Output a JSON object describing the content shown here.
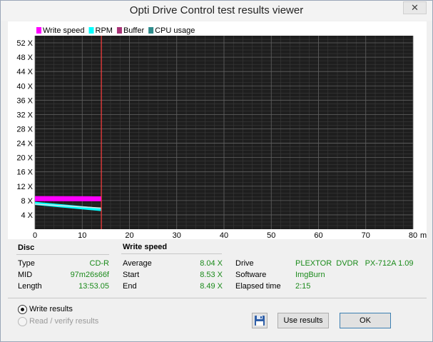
{
  "window": {
    "title": "Opti Drive Control test results viewer",
    "close_glyph": "✕"
  },
  "chart_data": {
    "type": "line",
    "legend": [
      {
        "name": "Write speed",
        "color": "#ff00ff"
      },
      {
        "name": "RPM",
        "color": "#00ffff"
      },
      {
        "name": "Buffer",
        "color": "#aa3377"
      },
      {
        "name": "CPU usage",
        "color": "#2e8b8b"
      }
    ],
    "legend_position": "top-left",
    "xlabel_unit": "min",
    "xlim": [
      0,
      80
    ],
    "ylim": [
      0,
      54
    ],
    "x_ticks": [
      0,
      10,
      20,
      30,
      40,
      50,
      60,
      70,
      80
    ],
    "y_ticks": [
      4,
      8,
      12,
      16,
      20,
      24,
      28,
      32,
      36,
      40,
      44,
      48,
      52
    ],
    "y_tick_suffix": " X",
    "grid": true,
    "background": "#1e1e1e",
    "marker_x": 14.05,
    "marker_color": "#ff3b3b",
    "series": [
      {
        "name": "Write speed",
        "color": "#ff00ff",
        "x": [
          0,
          14.05
        ],
        "y": [
          8.53,
          8.49
        ],
        "band": 1.4
      },
      {
        "name": "RPM",
        "color": "#00ffff",
        "x": [
          0,
          14.05
        ],
        "y": [
          7.2,
          5.5
        ],
        "band": 0.9
      },
      {
        "name": "CPU usage",
        "color": "#e0e0e0",
        "x": [
          0,
          14.05
        ],
        "y": [
          7.0,
          5.9
        ],
        "band": 0.3
      }
    ]
  },
  "disc": {
    "header": "Disc",
    "rows": [
      {
        "label": "Type",
        "value": "CD-R"
      },
      {
        "label": "MID",
        "value": "97m26s66f"
      },
      {
        "label": "Length",
        "value": "13:53.05"
      }
    ]
  },
  "write_speed": {
    "header": "Write speed",
    "rows": [
      {
        "label": "Average",
        "value": "8.04 X"
      },
      {
        "label": "Start",
        "value": "8.53 X"
      },
      {
        "label": "End",
        "value": "8.49 X"
      }
    ]
  },
  "drive": {
    "rows": [
      {
        "label": "Drive",
        "value": "PLEXTOR  DVDR   PX-712A 1.09"
      },
      {
        "label": "Software",
        "value": "ImgBurn"
      },
      {
        "label": "Elapsed time",
        "value": "2:15"
      }
    ]
  },
  "options": {
    "write_results": "Write results",
    "read_verify_results": "Read / verify results"
  },
  "buttons": {
    "use_results": "Use results",
    "ok": "OK"
  },
  "colors": {
    "green_value": "#1a8a1a",
    "chart_bg": "#1e1e1e"
  }
}
